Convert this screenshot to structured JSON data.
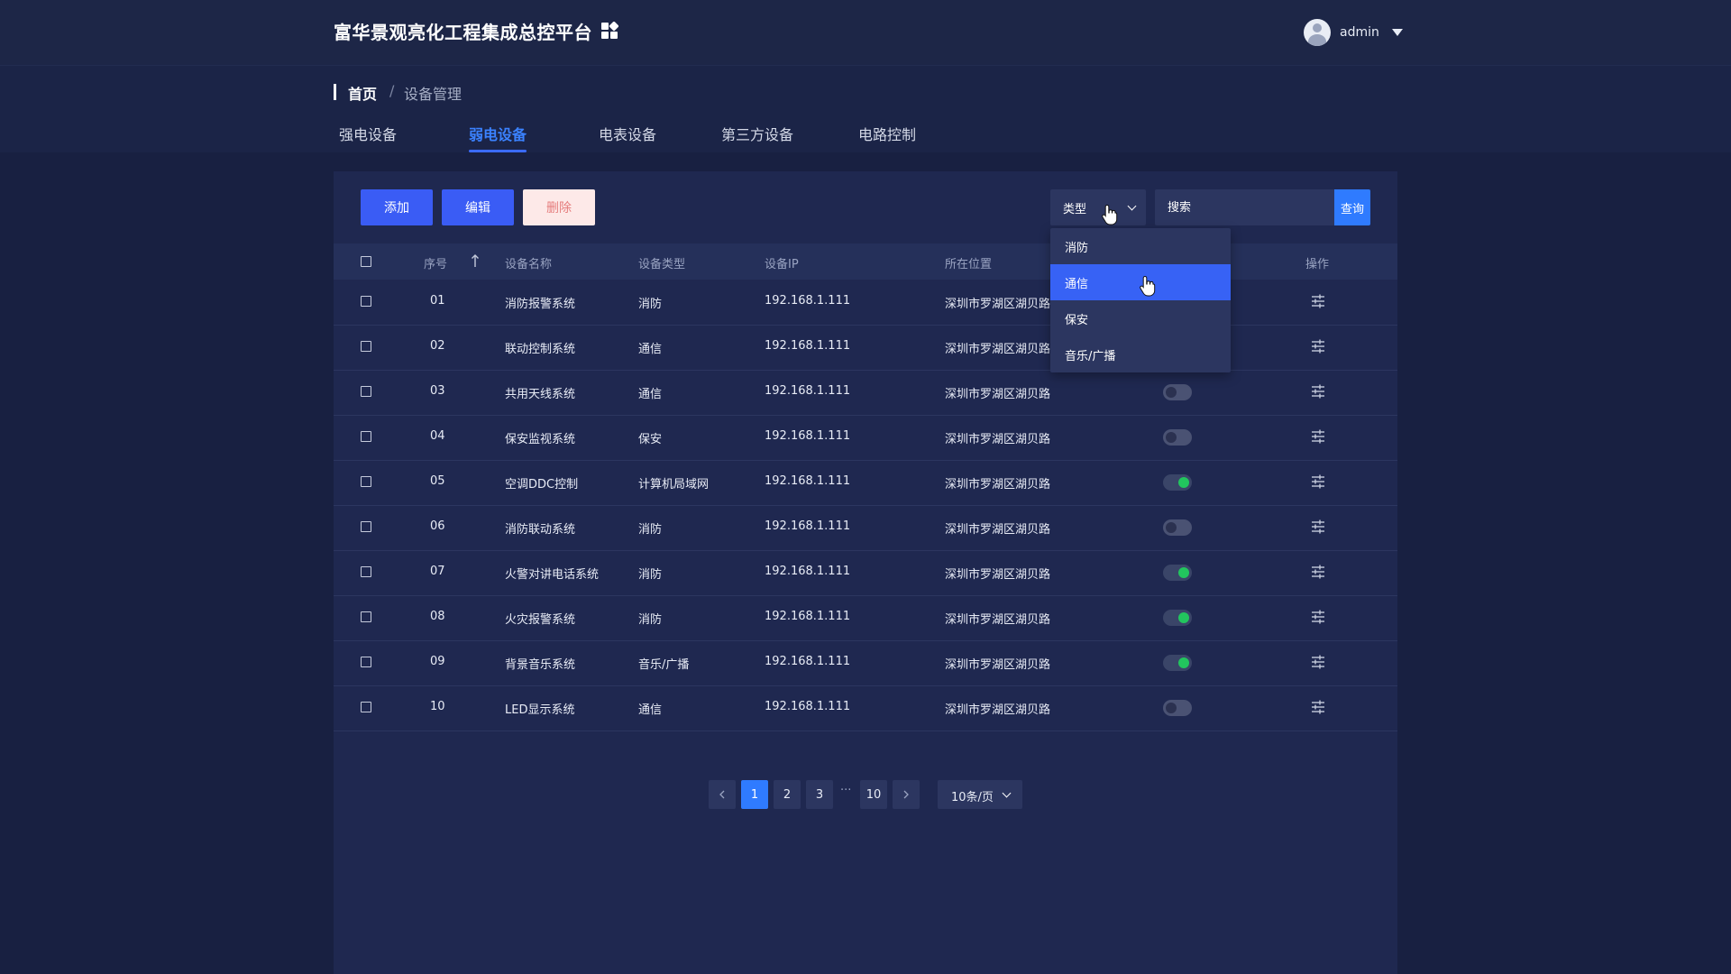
{
  "app": {
    "title": "富华景观亮化工程集成总控平台"
  },
  "user": {
    "name": "admin"
  },
  "breadcrumb": {
    "home": "首页",
    "separator": "/",
    "current": "设备管理"
  },
  "tabs": [
    {
      "label": "强电设备",
      "active": false
    },
    {
      "label": "弱电设备",
      "active": true
    },
    {
      "label": "电表设备",
      "active": false
    },
    {
      "label": "第三方设备",
      "active": false
    },
    {
      "label": "电路控制",
      "active": false
    }
  ],
  "toolbar": {
    "add_label": "添加",
    "edit_label": "编辑",
    "delete_label": "删除"
  },
  "filter": {
    "type_label": "类型",
    "search_placeholder": "搜索",
    "query_label": "查询"
  },
  "type_dropdown": {
    "options": [
      "消防",
      "通信",
      "保安",
      "音乐/广播"
    ],
    "highlighted": "通信"
  },
  "table": {
    "columns": [
      "序号",
      "设备名称",
      "设备类型",
      "设备IP",
      "所在位置",
      "操作"
    ],
    "rows": [
      {
        "index": "01",
        "name": "消防报警系统",
        "type": "消防",
        "ip": "192.168.1.111",
        "location": "深圳市罗湖区湖贝路",
        "enabled": null
      },
      {
        "index": "02",
        "name": "联动控制系统",
        "type": "通信",
        "ip": "192.168.1.111",
        "location": "深圳市罗湖区湖贝路",
        "enabled": null
      },
      {
        "index": "03",
        "name": "共用天线系统",
        "type": "通信",
        "ip": "192.168.1.111",
        "location": "深圳市罗湖区湖贝路",
        "enabled": false
      },
      {
        "index": "04",
        "name": "保安监视系统",
        "type": "保安",
        "ip": "192.168.1.111",
        "location": "深圳市罗湖区湖贝路",
        "enabled": false
      },
      {
        "index": "05",
        "name": "空调DDC控制",
        "type": "计算机局域网",
        "ip": "192.168.1.111",
        "location": "深圳市罗湖区湖贝路",
        "enabled": true
      },
      {
        "index": "06",
        "name": "消防联动系统",
        "type": "消防",
        "ip": "192.168.1.111",
        "location": "深圳市罗湖区湖贝路",
        "enabled": false
      },
      {
        "index": "07",
        "name": "火警对讲电话系统",
        "type": "消防",
        "ip": "192.168.1.111",
        "location": "深圳市罗湖区湖贝路",
        "enabled": true
      },
      {
        "index": "08",
        "name": "火灾报警系统",
        "type": "消防",
        "ip": "192.168.1.111",
        "location": "深圳市罗湖区湖贝路",
        "enabled": true
      },
      {
        "index": "09",
        "name": "背景音乐系统",
        "type": "音乐/广播",
        "ip": "192.168.1.111",
        "location": "深圳市罗湖区湖贝路",
        "enabled": true
      },
      {
        "index": "10",
        "name": "LED显示系统",
        "type": "通信",
        "ip": "192.168.1.111",
        "location": "深圳市罗湖区湖贝路",
        "enabled": false
      }
    ]
  },
  "pagination": {
    "pages": [
      "1",
      "2",
      "3"
    ],
    "ellipsis": "···",
    "last_page": "10",
    "current": "1",
    "page_size": "10条/页"
  },
  "colors": {
    "accent": "#3a5cf5",
    "toggle_on": "#22c55e",
    "delete": "#e57d7d"
  }
}
